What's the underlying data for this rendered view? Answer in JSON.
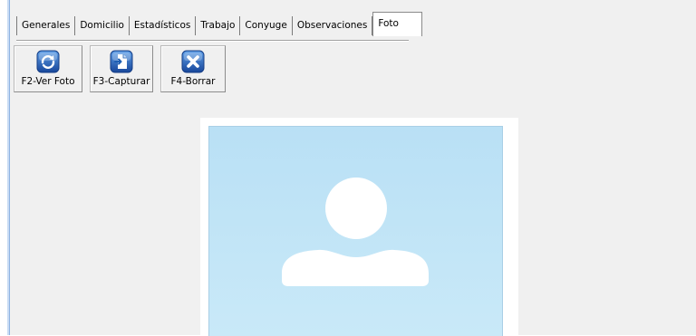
{
  "tabs": [
    {
      "label": "Generales",
      "active": false
    },
    {
      "label": "Domicilio",
      "active": false
    },
    {
      "label": "Estadísticos",
      "active": false
    },
    {
      "label": "Trabajo",
      "active": false
    },
    {
      "label": "Conyuge",
      "active": false
    },
    {
      "label": "Observaciones",
      "active": false
    },
    {
      "label": "Foto",
      "active": true
    }
  ],
  "toolbar": {
    "view_photo_label": "F2-Ver Foto",
    "capture_label": "F3-Capturar",
    "delete_label": "F4-Borrar"
  },
  "icons": {
    "view_photo": "refresh-photo-icon",
    "capture": "capture-document-icon",
    "delete": "delete-x-icon"
  },
  "photo": {
    "placeholder_icon": "user-silhouette-icon"
  },
  "colors": {
    "window_bg": "#f0f0f0",
    "photo_bg": "#c4e6f7",
    "icon_blue": "#1f5fb3",
    "frame_blue": "#8fb4e3"
  }
}
